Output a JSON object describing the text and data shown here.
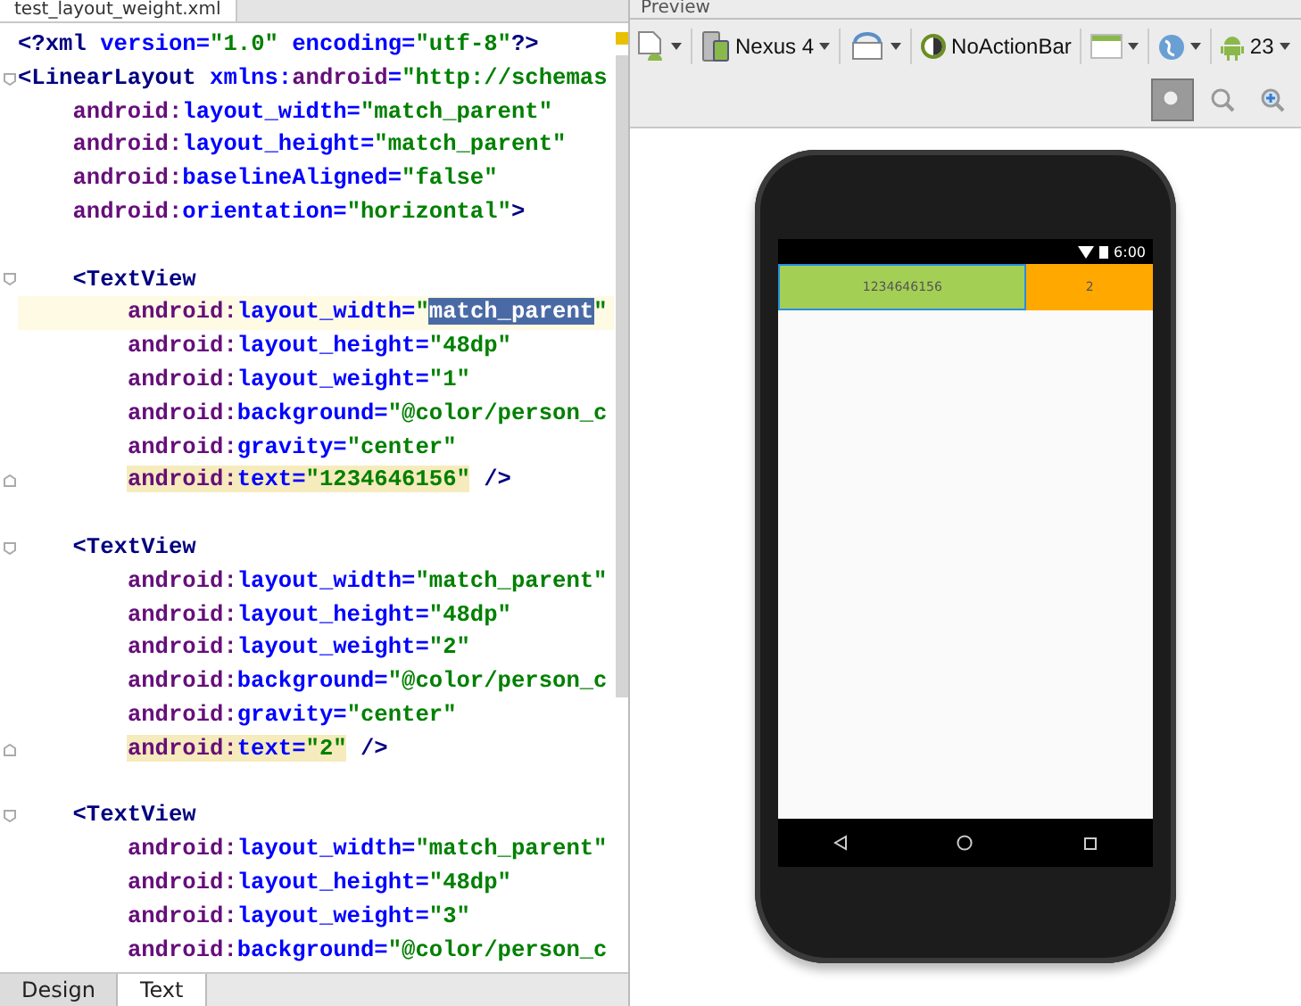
{
  "editor": {
    "file_tab": "test_layout_weight.xml",
    "lines": [
      {
        "kind": "plain",
        "caret_line": false,
        "segments": [
          {
            "kind": "tag",
            "text": "<?xml"
          },
          {
            "kind": "attr",
            "text": " version="
          },
          {
            "kind": "value",
            "text": "\"1.0\""
          },
          {
            "kind": "attr",
            "text": " encoding="
          },
          {
            "kind": "value",
            "text": "\"utf-8\""
          },
          {
            "kind": "tag",
            "text": "?>"
          }
        ]
      },
      {
        "kind": "fold_start",
        "caret_line": false,
        "segments": [
          {
            "kind": "tag",
            "text": "<LinearLayout"
          },
          {
            "kind": "attr",
            "text": " xmlns:"
          },
          {
            "kind": "ns",
            "text": "android"
          },
          {
            "kind": "attr",
            "text": "="
          },
          {
            "kind": "value",
            "text": "\"http://schemas"
          }
        ],
        "children": [
          {
            "kind": "plain",
            "caret_line": false,
            "segments": [
              {
                "kind": "ns",
                "text": "android:"
              },
              {
                "kind": "attr",
                "text": "layout_width="
              },
              {
                "kind": "value",
                "text": "\"match_parent\""
              }
            ]
          },
          {
            "kind": "plain",
            "caret_line": false,
            "segments": [
              {
                "kind": "ns",
                "text": "android:"
              },
              {
                "kind": "attr",
                "text": "layout_height="
              },
              {
                "kind": "value",
                "text": "\"match_parent\""
              }
            ]
          },
          {
            "kind": "plain",
            "caret_line": false,
            "segments": [
              {
                "kind": "ns",
                "text": "android:"
              },
              {
                "kind": "attr",
                "text": "baselineAligned="
              },
              {
                "kind": "value",
                "text": "\"false\""
              }
            ]
          },
          {
            "kind": "plain",
            "caret_line": false,
            "segments": [
              {
                "kind": "ns",
                "text": "android:"
              },
              {
                "kind": "attr",
                "text": "orientation="
              },
              {
                "kind": "value",
                "text": "\"horizontal\""
              },
              {
                "kind": "tag",
                "text": ">"
              }
            ]
          },
          {
            "kind": "blank"
          },
          {
            "kind": "fold_start",
            "caret_line": false,
            "segments": [
              {
                "kind": "tag",
                "text": "<TextView"
              }
            ],
            "children": [
              {
                "kind": "plain",
                "caret_line": true,
                "segments": [
                  {
                    "kind": "ns",
                    "text": "android:"
                  },
                  {
                    "kind": "attr",
                    "text": "layout_width="
                  },
                  {
                    "kind": "value",
                    "text": "\""
                  },
                  {
                    "kind": "value",
                    "text": "match_parent",
                    "selected": true
                  },
                  {
                    "kind": "value",
                    "text": "\""
                  }
                ]
              },
              {
                "kind": "plain",
                "caret_line": false,
                "segments": [
                  {
                    "kind": "ns",
                    "text": "android:"
                  },
                  {
                    "kind": "attr",
                    "text": "layout_height="
                  },
                  {
                    "kind": "value",
                    "text": "\"48dp\""
                  }
                ]
              },
              {
                "kind": "plain",
                "caret_line": false,
                "segments": [
                  {
                    "kind": "ns",
                    "text": "android:"
                  },
                  {
                    "kind": "attr",
                    "text": "layout_weight="
                  },
                  {
                    "kind": "value",
                    "text": "\"1\""
                  }
                ]
              },
              {
                "kind": "plain",
                "caret_line": false,
                "segments": [
                  {
                    "kind": "ns",
                    "text": "android:"
                  },
                  {
                    "kind": "attr",
                    "text": "background="
                  },
                  {
                    "kind": "value",
                    "text": "\"@color/person_c"
                  }
                ]
              },
              {
                "kind": "plain",
                "caret_line": false,
                "segments": [
                  {
                    "kind": "ns",
                    "text": "android:"
                  },
                  {
                    "kind": "attr",
                    "text": "gravity="
                  },
                  {
                    "kind": "value",
                    "text": "\"center\""
                  }
                ]
              },
              {
                "kind": "fold_end",
                "caret_line": false,
                "segments": [
                  {
                    "kind": "ns",
                    "text": "android:",
                    "highlighted": true
                  },
                  {
                    "kind": "attr",
                    "text": "text=",
                    "highlighted": true
                  },
                  {
                    "kind": "value",
                    "text": "\"1234646156\"",
                    "highlighted": true
                  },
                  {
                    "kind": "tag",
                    "text": " />"
                  }
                ]
              }
            ]
          },
          {
            "kind": "blank"
          },
          {
            "kind": "fold_start",
            "caret_line": false,
            "segments": [
              {
                "kind": "tag",
                "text": "<TextView"
              }
            ],
            "children": [
              {
                "kind": "plain",
                "caret_line": false,
                "segments": [
                  {
                    "kind": "ns",
                    "text": "android:"
                  },
                  {
                    "kind": "attr",
                    "text": "layout_width="
                  },
                  {
                    "kind": "value",
                    "text": "\"match_parent\""
                  }
                ]
              },
              {
                "kind": "plain",
                "caret_line": false,
                "segments": [
                  {
                    "kind": "ns",
                    "text": "android:"
                  },
                  {
                    "kind": "attr",
                    "text": "layout_height="
                  },
                  {
                    "kind": "value",
                    "text": "\"48dp\""
                  }
                ]
              },
              {
                "kind": "plain",
                "caret_line": false,
                "segments": [
                  {
                    "kind": "ns",
                    "text": "android:"
                  },
                  {
                    "kind": "attr",
                    "text": "layout_weight="
                  },
                  {
                    "kind": "value",
                    "text": "\"2\""
                  }
                ]
              },
              {
                "kind": "plain",
                "caret_line": false,
                "segments": [
                  {
                    "kind": "ns",
                    "text": "android:"
                  },
                  {
                    "kind": "attr",
                    "text": "background="
                  },
                  {
                    "kind": "value",
                    "text": "\"@color/person_c"
                  }
                ]
              },
              {
                "kind": "plain",
                "caret_line": false,
                "segments": [
                  {
                    "kind": "ns",
                    "text": "android:"
                  },
                  {
                    "kind": "attr",
                    "text": "gravity="
                  },
                  {
                    "kind": "value",
                    "text": "\"center\""
                  }
                ]
              },
              {
                "kind": "fold_end",
                "caret_line": false,
                "segments": [
                  {
                    "kind": "ns",
                    "text": "android:",
                    "highlighted": true
                  },
                  {
                    "kind": "attr",
                    "text": "text=",
                    "highlighted": true
                  },
                  {
                    "kind": "value",
                    "text": "\"2\"",
                    "highlighted": true
                  },
                  {
                    "kind": "tag",
                    "text": " />"
                  }
                ]
              }
            ]
          },
          {
            "kind": "blank"
          },
          {
            "kind": "fold_start",
            "caret_line": false,
            "segments": [
              {
                "kind": "tag",
                "text": "<TextView"
              }
            ],
            "children": [
              {
                "kind": "plain",
                "caret_line": false,
                "segments": [
                  {
                    "kind": "ns",
                    "text": "android:"
                  },
                  {
                    "kind": "attr",
                    "text": "layout_width="
                  },
                  {
                    "kind": "value",
                    "text": "\"match_parent\""
                  }
                ]
              },
              {
                "kind": "plain",
                "caret_line": false,
                "segments": [
                  {
                    "kind": "ns",
                    "text": "android:"
                  },
                  {
                    "kind": "attr",
                    "text": "layout_height="
                  },
                  {
                    "kind": "value",
                    "text": "\"48dp\""
                  }
                ]
              },
              {
                "kind": "plain",
                "caret_line": false,
                "segments": [
                  {
                    "kind": "ns",
                    "text": "android:"
                  },
                  {
                    "kind": "attr",
                    "text": "layout_weight="
                  },
                  {
                    "kind": "value",
                    "text": "\"3\""
                  }
                ]
              },
              {
                "kind": "plain",
                "caret_line": false,
                "segments": [
                  {
                    "kind": "ns",
                    "text": "android:"
                  },
                  {
                    "kind": "attr",
                    "text": "background="
                  },
                  {
                    "kind": "value",
                    "text": "\"@color/person_c"
                  }
                ]
              }
            ]
          }
        ]
      }
    ],
    "bottom_tabs": [
      {
        "label": "Design",
        "selected": false
      },
      {
        "label": "Text",
        "selected": true
      }
    ]
  },
  "preview": {
    "title": "Preview",
    "toolbar": {
      "device": "Nexus 4",
      "theme": "NoActionBar",
      "api_level": "23"
    },
    "zoom_buttons": [
      {
        "selected": true
      },
      {
        "selected": false
      },
      {
        "selected": false
      }
    ],
    "phone": {
      "clock": "6:00",
      "views": [
        {
          "text": "1234646156",
          "color": "#a4cf55",
          "selected": true
        },
        {
          "text": "2",
          "color": "#ffa800",
          "selected": false
        }
      ]
    }
  }
}
